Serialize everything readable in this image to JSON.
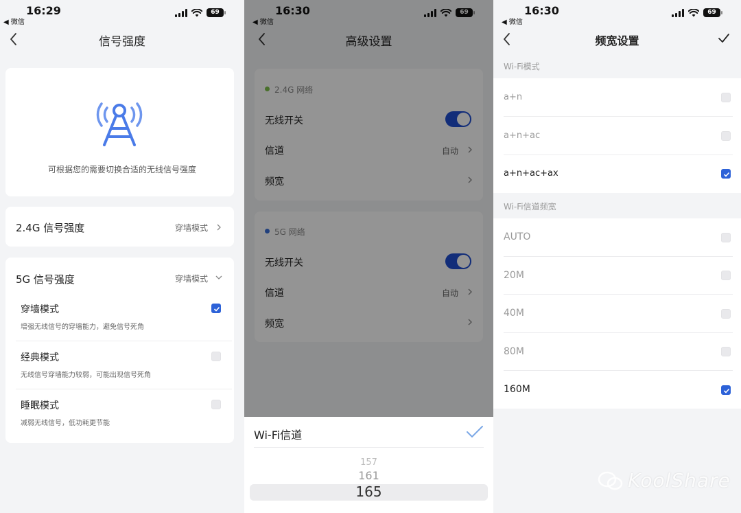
{
  "screens": [
    {
      "status": {
        "time": "16:29",
        "back_app": "◀ 微信",
        "battery": "69"
      },
      "title": "信号强度",
      "hero_hint": "可根据您的需要切换合适的无线信号强度",
      "band_24": {
        "label": "2.4G 信号强度",
        "value": "穿墙模式"
      },
      "band_5": {
        "label": "5G 信号强度",
        "value": "穿墙模式"
      },
      "modes": [
        {
          "title": "穿墙模式",
          "desc": "增强无线信号的穿墙能力，避免信号死角",
          "checked": true
        },
        {
          "title": "经典模式",
          "desc": "无线信号穿墙能力较弱，可能出现信号死角",
          "checked": false
        },
        {
          "title": "睡眠模式",
          "desc": "减弱无线信号，低功耗更节能",
          "checked": false
        }
      ]
    },
    {
      "status": {
        "time": "16:30",
        "back_app": "◀ 微信",
        "battery": "69"
      },
      "title": "高级设置",
      "sections": [
        {
          "name": "2.4G 网络",
          "dot_color": "#7fc24a",
          "wireless": "无线开关",
          "channel": "信道",
          "channel_value": "自动",
          "bandwidth": "频宽"
        },
        {
          "name": "5G 网络",
          "dot_color": "#3a6fd8",
          "wireless": "无线开关",
          "channel": "信道",
          "channel_value": "自动",
          "bandwidth": "频宽"
        }
      ],
      "sheet": {
        "title": "Wi-Fi信道",
        "picker": [
          "157",
          "161",
          "165"
        ],
        "selected": "165"
      }
    },
    {
      "status": {
        "time": "16:30",
        "back_app": "◀ 微信",
        "battery": "69"
      },
      "title": "频宽设置",
      "wifi_mode_title": "Wi-Fi模式",
      "wifi_modes": [
        {
          "label": "a+n",
          "checked": false
        },
        {
          "label": "a+n+ac",
          "checked": false
        },
        {
          "label": "a+n+ac+ax",
          "checked": true
        }
      ],
      "bandwidth_title": "Wi-Fi信道频宽",
      "bandwidths": [
        {
          "label": "AUTO",
          "checked": false
        },
        {
          "label": "20M",
          "checked": false
        },
        {
          "label": "40M",
          "checked": false
        },
        {
          "label": "80M",
          "checked": false
        },
        {
          "label": "160M",
          "checked": true
        }
      ]
    }
  ],
  "watermark": "KoolShare",
  "colors": {
    "accent": "#2d62d8",
    "toggle": "#1f4ed0",
    "tower": "#4a7be8"
  }
}
